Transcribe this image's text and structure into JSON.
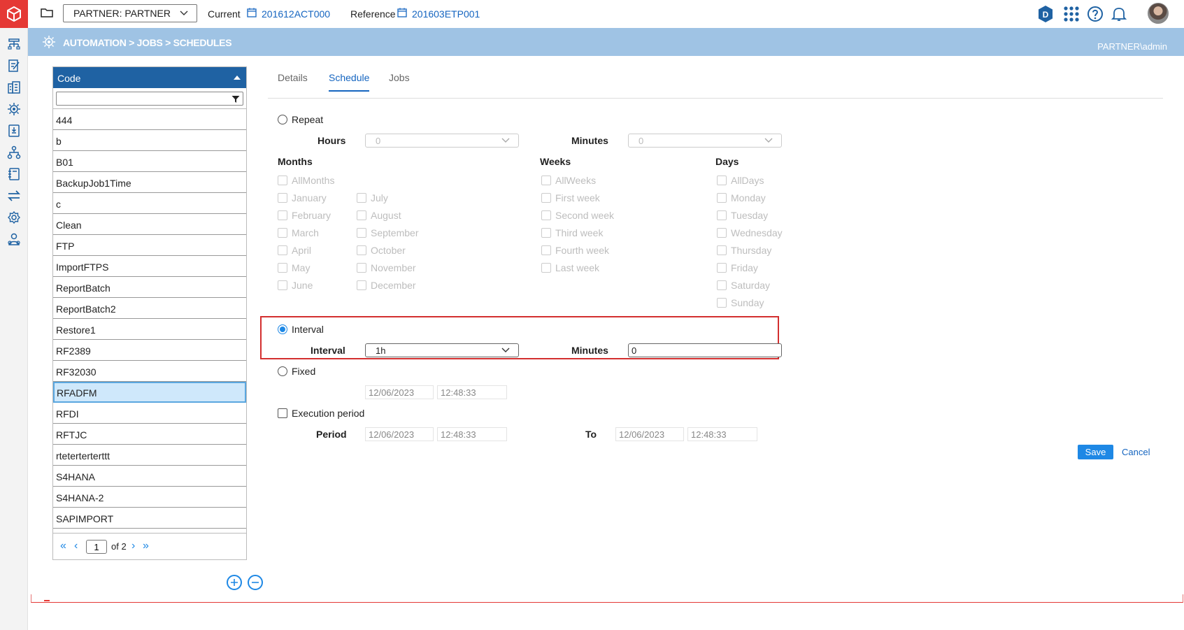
{
  "app": {
    "brand_color": "#e53935",
    "accent_color": "#1e88e5",
    "header_color": "#1f62a3",
    "crumb_color": "#9fc3e4"
  },
  "topbar": {
    "partner_select": "PARTNER: PARTNER",
    "current_label": "Current",
    "current_value": "201612ACT000",
    "reference_label": "Reference",
    "reference_value": "201603ETP001",
    "icons": [
      "d-badge-icon",
      "apps-grid-icon",
      "help-icon",
      "bell-icon",
      "user-avatar"
    ]
  },
  "breadcrumb": {
    "path": "AUTOMATION > JOBS > SCHEDULES",
    "user": "PARTNER\\admin"
  },
  "sidebar": {
    "icons": [
      "hierarchy-icon",
      "edit-document-icon",
      "building-icon",
      "automation-gear-icon",
      "report-icon",
      "network-icon",
      "notebook-icon",
      "transfer-icon",
      "settings-icon",
      "users-icon"
    ]
  },
  "list": {
    "header": "Code",
    "filter_value": "",
    "items": [
      "444",
      "b",
      "B01",
      "BackupJob1Time",
      "c",
      "Clean",
      "FTP",
      "ImportFTPS",
      "ReportBatch",
      "ReportBatch2",
      "Restore1",
      "RF2389",
      "RF32030",
      "RFADFM",
      "RFDI",
      "RFTJC",
      "rteterterterttt",
      "S4HANA",
      "S4HANA-2",
      "SAPIMPORT"
    ],
    "selected": "RFADFM",
    "pager": {
      "page": "1",
      "of_label": "of",
      "total": "2"
    }
  },
  "tabs": [
    "Details",
    "Schedule",
    "Jobs"
  ],
  "active_tab": "Schedule",
  "form": {
    "repeat": {
      "label": "Repeat",
      "hours_label": "Hours",
      "hours_value": "0",
      "minutes_label": "Minutes",
      "minutes_value": "0"
    },
    "months": {
      "label": "Months",
      "all": "AllMonths",
      "col1": [
        "January",
        "February",
        "March",
        "April",
        "May",
        "June"
      ],
      "col2": [
        "July",
        "August",
        "September",
        "October",
        "November",
        "December"
      ]
    },
    "weeks": {
      "label": "Weeks",
      "all": "AllWeeks",
      "items": [
        "First week",
        "Second week",
        "Third week",
        "Fourth week",
        "Last week"
      ]
    },
    "days": {
      "label": "Days",
      "all": "AllDays",
      "items": [
        "Monday",
        "Tuesday",
        "Wednesday",
        "Thursday",
        "Friday",
        "Saturday",
        "Sunday"
      ]
    },
    "interval": {
      "label": "Interval",
      "interval_label": "Interval",
      "interval_value": "1h",
      "minutes_label": "Minutes",
      "minutes_value": "0"
    },
    "fixed": {
      "label": "Fixed",
      "date": "12/06/2023",
      "time": "12:48:33"
    },
    "execution": {
      "label": "Execution period",
      "period_label": "Period",
      "from_date": "12/06/2023",
      "from_time": "12:48:33",
      "to_label": "To",
      "to_date": "12/06/2023",
      "to_time": "12:48:33"
    },
    "save_label": "Save",
    "cancel_label": "Cancel"
  }
}
